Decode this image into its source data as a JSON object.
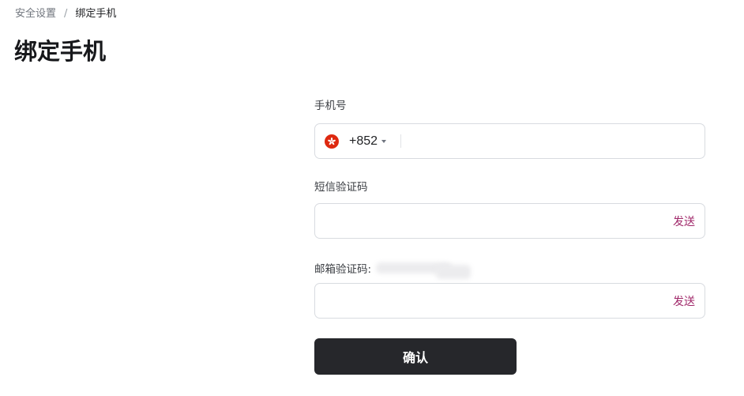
{
  "breadcrumb": {
    "parent": "安全设置",
    "separator": "/",
    "current": "绑定手机"
  },
  "page_title": "绑定手机",
  "form": {
    "phone": {
      "label": "手机号",
      "country_flag": "hong-kong-flag-icon",
      "dial_code": "+852",
      "value": "",
      "placeholder": ""
    },
    "sms_code": {
      "label": "短信验证码",
      "value": "",
      "send_label": "发送"
    },
    "email_code": {
      "label": "邮箱验证码:",
      "value": "",
      "send_label": "发送"
    },
    "confirm_label": "确认"
  },
  "colors": {
    "accent_link": "#a12a6b",
    "primary_button": "#26272b",
    "flag_red": "#de2910"
  }
}
